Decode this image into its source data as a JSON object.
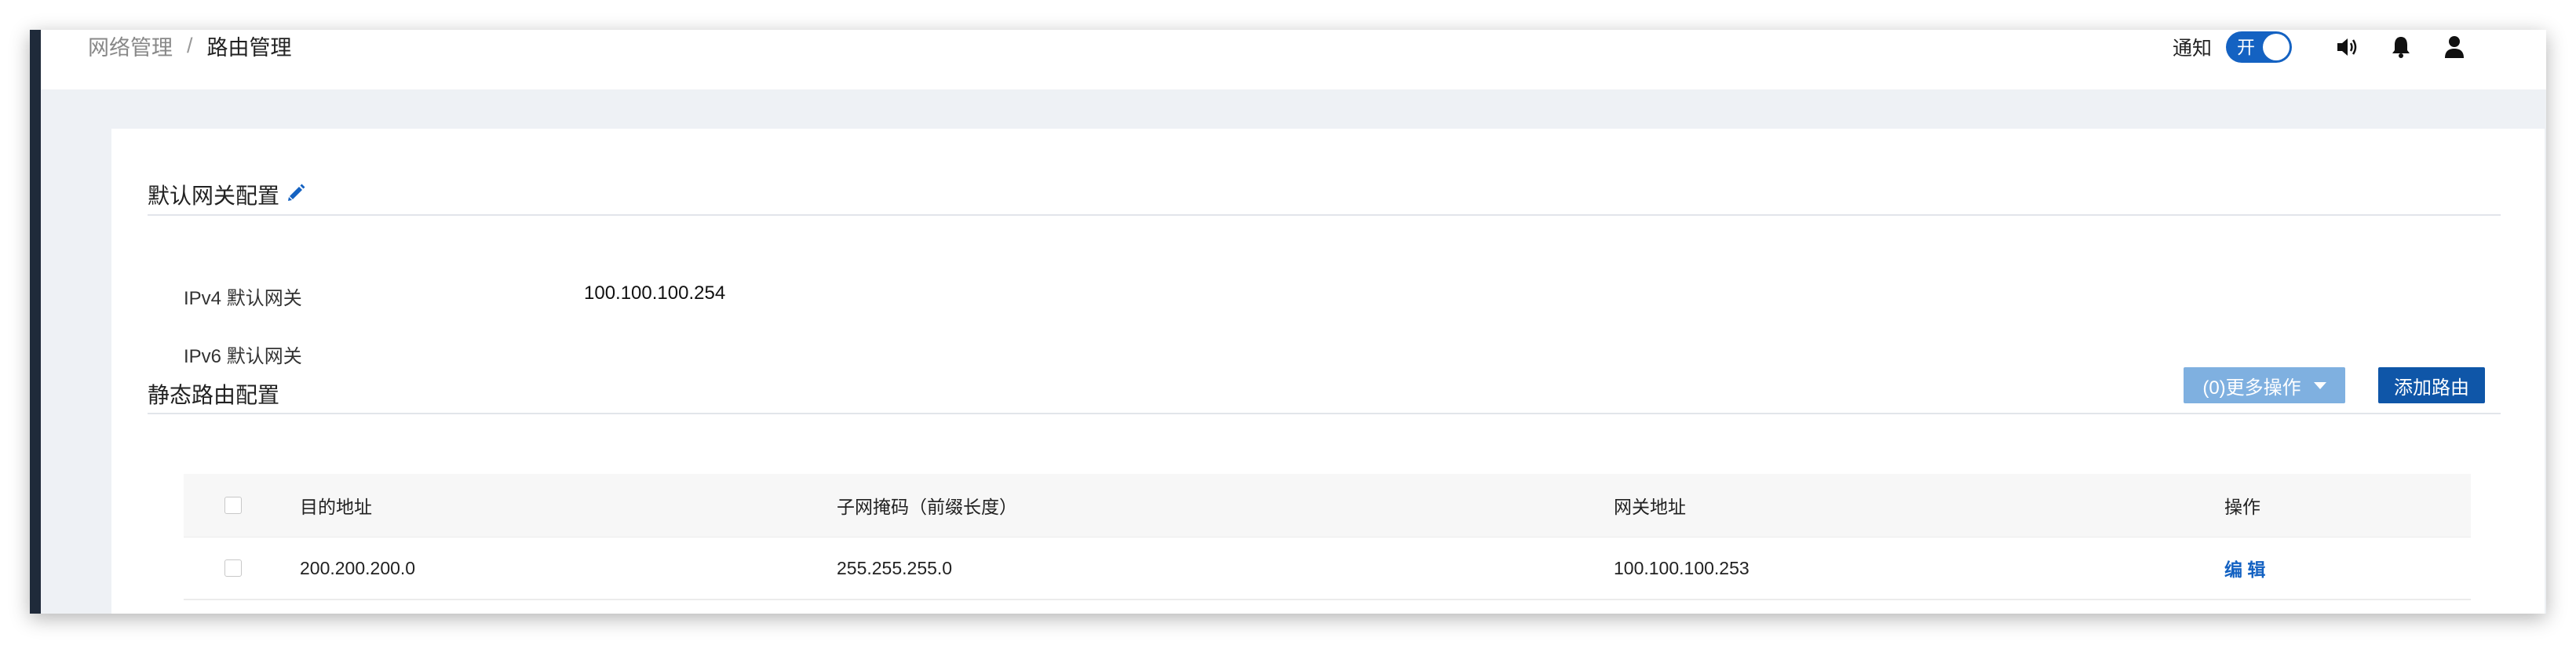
{
  "breadcrumb": {
    "parent": "网络管理",
    "separator": "/",
    "current": "路由管理"
  },
  "topbar": {
    "notify_label": "通知",
    "notify_toggle_text": "开"
  },
  "gateway": {
    "title": "默认网关配置",
    "ipv4_label": "IPv4 默认网关",
    "ipv4_value": "100.100.100.254",
    "ipv6_label": "IPv6 默认网关",
    "ipv6_value": ""
  },
  "routes": {
    "title": "静态路由配置",
    "more_actions_label": "(0)更多操作",
    "add_route_label": "添加路由",
    "columns": [
      "目的地址",
      "子网掩码（前缀长度）",
      "网关地址",
      "操作"
    ],
    "rows": [
      {
        "destination": "200.200.200.0",
        "mask": "255.255.255.0",
        "gateway": "100.100.100.253",
        "action": "编 辑"
      }
    ]
  },
  "colors": {
    "accent": "#1462c2",
    "primary_button": "#0f56a8",
    "disabled_button": "#7fb0e0",
    "sidebar": "#1f2a3a"
  },
  "icons": [
    "edit-icon",
    "speaker-icon",
    "bell-icon",
    "user-icon",
    "caret-down-icon"
  ]
}
